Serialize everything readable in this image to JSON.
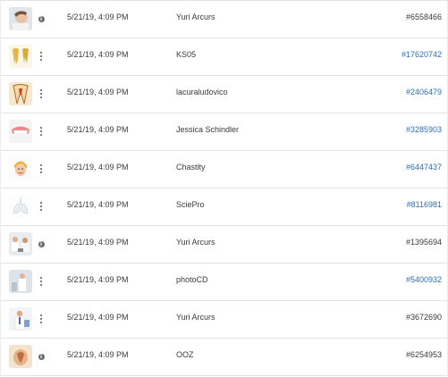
{
  "rows": [
    {
      "date": "5/21/19, 4:09 PM",
      "author": "Yuri Arcurs",
      "id": "#6558466",
      "id_is_link": false,
      "control": "info",
      "thumb": "woman-at-dentist"
    },
    {
      "date": "5/21/19, 4:09 PM",
      "author": "KS05",
      "id": "#17620742",
      "id_is_link": true,
      "control": "menu",
      "thumb": "golden-teeth"
    },
    {
      "date": "5/21/19, 4:09 PM",
      "author": "lacuraludovico",
      "id": "#2406479",
      "id_is_link": true,
      "control": "menu",
      "thumb": "tooth-cross-section"
    },
    {
      "date": "5/21/19, 4:09 PM",
      "author": "Jessica Schindler",
      "id": "#3285903",
      "id_is_link": true,
      "control": "menu",
      "thumb": "denture"
    },
    {
      "date": "5/21/19, 4:09 PM",
      "author": "Chastity",
      "id": "#6447437",
      "id_is_link": true,
      "control": "menu",
      "thumb": "cartoon-face"
    },
    {
      "date": "5/21/19, 4:09 PM",
      "author": "SciePro",
      "id": "#8116981",
      "id_is_link": true,
      "control": "menu",
      "thumb": "lungs-anatomy"
    },
    {
      "date": "5/21/19, 4:09 PM",
      "author": "Yuri Arcurs",
      "id": "#1395694",
      "id_is_link": false,
      "control": "info",
      "thumb": "doctors-group"
    },
    {
      "date": "5/21/19, 4:09 PM",
      "author": "photoCD",
      "id": "#5400932",
      "id_is_link": true,
      "control": "menu",
      "thumb": "doctor-standing"
    },
    {
      "date": "5/21/19, 4:09 PM",
      "author": "Yuri Arcurs",
      "id": "#3672690",
      "id_is_link": false,
      "control": "menu",
      "thumb": "doctor-with-chart"
    },
    {
      "date": "5/21/19, 4:09 PM",
      "author": "OOZ",
      "id": "#6254953",
      "id_is_link": false,
      "control": "info",
      "thumb": "anatomy-model"
    }
  ],
  "colors": {
    "link": "#2d6fb6",
    "text": "#3a3a3a",
    "divider": "#e3e3e3"
  }
}
